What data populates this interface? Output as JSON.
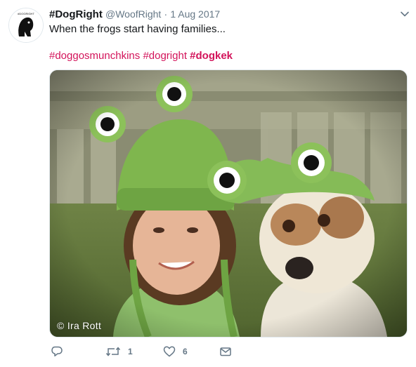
{
  "tweet": {
    "display_name": "#DogRight",
    "handle": "@WoofRight",
    "separator": "·",
    "date": "1 Aug 2017",
    "text": "When the frogs start having families...",
    "hashtags": [
      {
        "text": "#doggosmunchkins",
        "bold": false
      },
      {
        "text": "#dogright",
        "bold": false
      },
      {
        "text": "#dogkek",
        "bold": true
      }
    ],
    "photo_credit": "Ira Rott",
    "copyright_symbol": "©",
    "avatar_badge": "#DOGRIGHT"
  },
  "actions": {
    "reply_icon": "reply-icon",
    "retweet_icon": "retweet-icon",
    "retweet_count": "1",
    "like_icon": "heart-icon",
    "like_count": "6",
    "dm_icon": "envelope-icon"
  },
  "colors": {
    "hashtag": "#d3135a",
    "meta_gray": "#657786",
    "text": "#14171a"
  }
}
